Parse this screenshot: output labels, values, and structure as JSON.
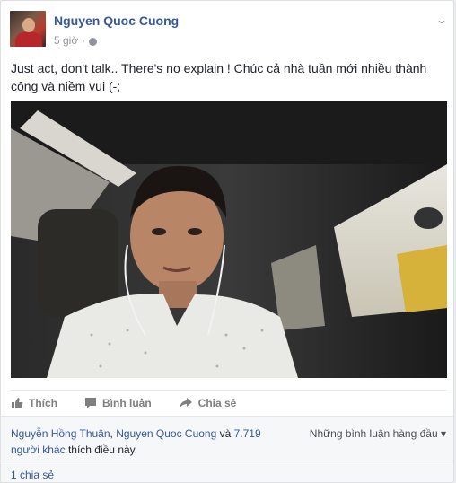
{
  "post": {
    "author": "Nguyen Quoc Cuong",
    "time": "5 giờ",
    "separator": "·",
    "text": "Just act, don't talk.. There's no explain ! Chúc cả nhà tuần mới nhiều thành công và niềm vui (-;"
  },
  "actions": {
    "like": "Thích",
    "comment": "Bình luận",
    "share": "Chia sẻ"
  },
  "reactions": {
    "name_1": "Nguyễn Hồng Thuận",
    "comma": ", ",
    "name_2": "Nguyen Quoc Cuong",
    "and": " và ",
    "others": "7.719 người khác",
    "suffix": " thích điều này.",
    "top_comments": "Những bình luận hàng đầu",
    "top_comments_arrow": "▾"
  },
  "shares": {
    "label": "1 chia sẻ"
  },
  "icons": {
    "globe": "globe-icon",
    "chevron": "chevron-down-icon",
    "like": "thumbs-up-icon",
    "comment": "comment-icon",
    "share": "share-arrow-icon"
  },
  "colors": {
    "link": "#365899",
    "meta": "#90949c",
    "action": "#7f7f7f",
    "text": "#1d2129"
  }
}
